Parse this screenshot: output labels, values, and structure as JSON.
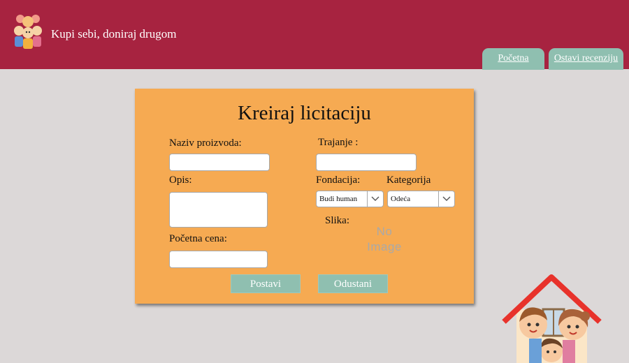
{
  "header": {
    "site_title": "Kupi sebi, doniraj drugom",
    "nav": {
      "home": "Početna",
      "review": "Ostavi recenziju"
    }
  },
  "form": {
    "title": "Kreiraj licitaciju",
    "product_name": {
      "label": "Naziv proizvoda:",
      "value": ""
    },
    "duration": {
      "label": "Trajanje :",
      "value": ""
    },
    "description": {
      "label": "Opis:",
      "value": ""
    },
    "foundation": {
      "label": "Fondacija:",
      "selected": "Budi human"
    },
    "category": {
      "label": "Kategorija",
      "selected": "Odeća"
    },
    "image": {
      "label": "Slika:",
      "placeholder_line1": "No",
      "placeholder_line2": "Image"
    },
    "start_price": {
      "label": "Početna cena:",
      "value": ""
    },
    "submit_label": "Postavi",
    "cancel_label": "Odustani"
  },
  "colors": {
    "header": "#a72340",
    "accent": "#8fbfb0",
    "card": "#f6aa52",
    "background": "#dcd8d8"
  }
}
